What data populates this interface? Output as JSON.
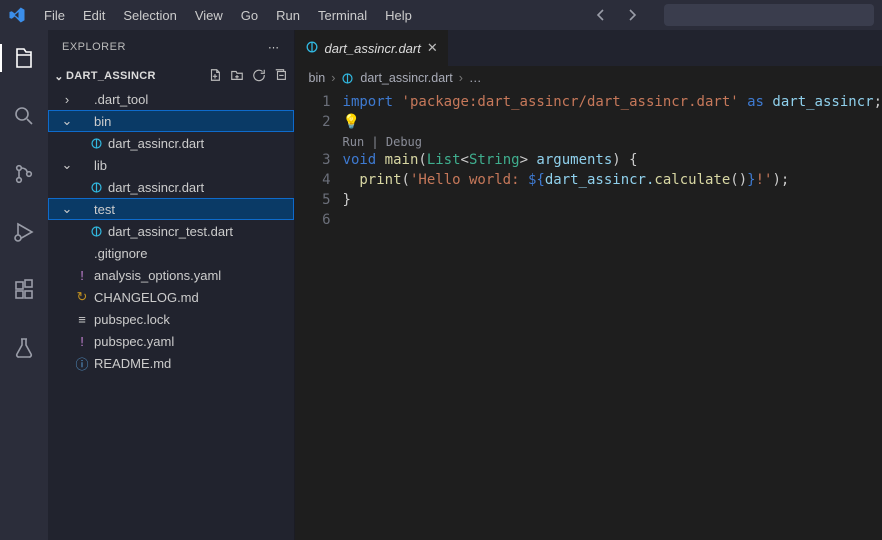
{
  "menu": [
    "File",
    "Edit",
    "Selection",
    "View",
    "Go",
    "Run",
    "Terminal",
    "Help"
  ],
  "explorer": {
    "title": "Explorer",
    "section": "DART_ASSINCR",
    "tree": [
      {
        "kind": "folder",
        "depth": 0,
        "open": false,
        "label": ".dart_tool",
        "sel": false
      },
      {
        "kind": "folder",
        "depth": 0,
        "open": true,
        "label": "bin",
        "sel": true
      },
      {
        "kind": "file",
        "depth": 1,
        "icon": "dart",
        "label": "dart_assincr.dart",
        "sel": false
      },
      {
        "kind": "folder",
        "depth": 0,
        "open": true,
        "label": "lib",
        "sel": false
      },
      {
        "kind": "file",
        "depth": 1,
        "icon": "dart",
        "label": "dart_assincr.dart",
        "sel": false
      },
      {
        "kind": "folder",
        "depth": 0,
        "open": true,
        "label": "test",
        "sel": true
      },
      {
        "kind": "file",
        "depth": 1,
        "icon": "dart",
        "label": "dart_assincr_test.dart",
        "sel": false
      },
      {
        "kind": "file",
        "depth": 0,
        "icon": "git",
        "label": ".gitignore",
        "sel": false
      },
      {
        "kind": "file",
        "depth": 0,
        "icon": "purple",
        "glyph": "!",
        "label": "analysis_options.yaml",
        "sel": false
      },
      {
        "kind": "file",
        "depth": 0,
        "icon": "yellow",
        "glyph": "↻",
        "label": "CHANGELOG.md",
        "sel": false
      },
      {
        "kind": "file",
        "depth": 0,
        "icon": "gray",
        "glyph": "≡",
        "label": "pubspec.lock",
        "sel": false
      },
      {
        "kind": "file",
        "depth": 0,
        "icon": "purple",
        "glyph": "!",
        "label": "pubspec.yaml",
        "sel": false
      },
      {
        "kind": "file",
        "depth": 0,
        "icon": "info",
        "glyph": "ⓘ",
        "label": "README.md",
        "sel": false
      }
    ]
  },
  "tab": {
    "label": "dart_assincr.dart"
  },
  "breadcrumbs": {
    "a": "bin",
    "b": "dart_assincr.dart",
    "c": "…"
  },
  "codelens": "Run | Debug",
  "code": {
    "lines": [
      "1",
      "2",
      "3",
      "4",
      "5",
      "6"
    ],
    "l1_import": "import ",
    "l1_pkg": "'package:dart_assincr/dart_assincr.dart'",
    "l1_as": " as ",
    "l1_alias": "dart_assincr",
    "l1_semi": ";",
    "l3_void": "void ",
    "l3_main": "main",
    "l3_open": "(",
    "l3_list": "List",
    "l3_lt": "<",
    "l3_string": "String",
    "l3_gt": "> ",
    "l3_args": "arguments",
    "l3_close": ") {",
    "l4_indent": "  ",
    "l4_print": "print",
    "l4_open": "(",
    "l4_s1": "'Hello world: ",
    "l4_i1": "${",
    "l4_obj": "dart_assincr.",
    "l4_calc": "calculate",
    "l4_par": "()",
    "l4_i2": "}",
    "l4_s2": "!'",
    "l4_close": ");",
    "l5": "}"
  }
}
